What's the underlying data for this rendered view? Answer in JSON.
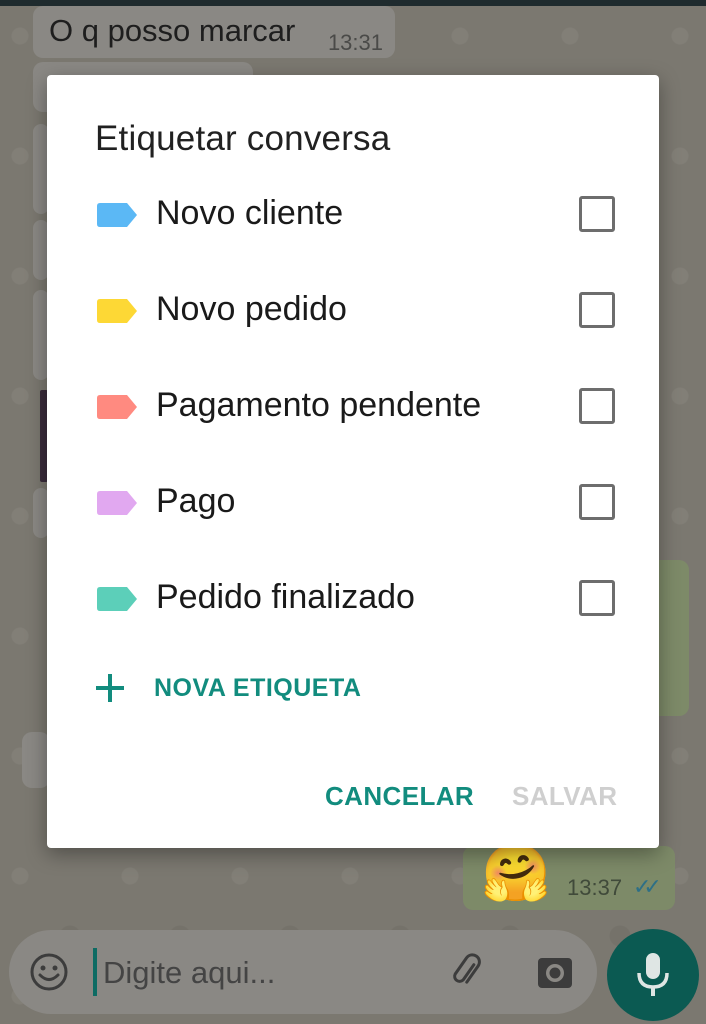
{
  "chat": {
    "first_message": "O q posso marcar",
    "first_message_time": "13:31",
    "last_message_emoji": "🤗",
    "last_message_time": "13:37",
    "read_ticks": "✓✓",
    "ticks_color": "#2d6f86"
  },
  "composer": {
    "placeholder": "Digite aqui...",
    "emoji_icon": "smiley-icon",
    "attach_icon": "paperclip-icon",
    "camera_icon": "camera-icon",
    "mic_icon": "microphone-icon"
  },
  "dialog": {
    "title": "Etiquetar conversa",
    "labels": [
      {
        "name": "Novo cliente",
        "color": "#5bb8f5",
        "checked": false
      },
      {
        "name": "Novo pedido",
        "color": "#fdd835",
        "checked": false
      },
      {
        "name": "Pagamento pendente",
        "color": "#ff8a80",
        "checked": false
      },
      {
        "name": "Pago",
        "color": "#e1a8f0",
        "checked": false
      },
      {
        "name": "Pedido finalizado",
        "color": "#5ccfb9",
        "checked": false
      }
    ],
    "new_label": "NOVA ETIQUETA",
    "cancel_label": "CANCELAR",
    "save_label": "SALVAR",
    "accent_color": "#128c7e"
  }
}
